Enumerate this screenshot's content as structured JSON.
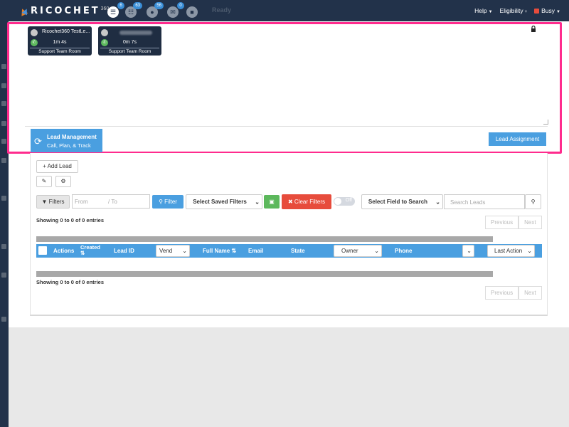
{
  "app": {
    "logo_text": "RICOCHET",
    "logo_number": "360",
    "status": "Ready"
  },
  "topbar": {
    "icons": [
      {
        "icon": "phone-book-icon",
        "badge": "6"
      },
      {
        "icon": "document-icon",
        "badge": "63"
      },
      {
        "icon": "chat-icon",
        "badge": "56"
      },
      {
        "icon": "mail-icon",
        "badge": "0"
      },
      {
        "icon": "inbox-icon",
        "badge": ""
      }
    ],
    "help_label": "Help",
    "eligibility_label": "Eligibility",
    "busy_label": "Busy",
    "busy_color": "#e74c3c"
  },
  "call_panel": {
    "cards": [
      {
        "name": "Ricochet360 TestLe...",
        "duration": "1m 4s",
        "room": "Support Team Room"
      },
      {
        "name": "",
        "duration": "0m 7s",
        "room": "Support Team Room"
      }
    ],
    "lead_management_title": "Lead Management",
    "lead_management_subtitle": "Call, Plan, & Track",
    "lead_assignment_label": "Lead Assignment"
  },
  "toolbar": {
    "add_lead_label": "Add Lead",
    "filters_label": "Filters",
    "from_placeholder": "From",
    "to_placeholder": "To",
    "filter_label": "Filter",
    "saved_filters_label": "Select Saved Filters",
    "clear_filters_label": "Clear Filters",
    "toggle_label": "Off",
    "search_field_label": "Select Field to Search",
    "search_placeholder": "Search Leads"
  },
  "table": {
    "info_top": "Showing 0 to 0 of 0 entries",
    "info_bottom": "Showing 0 to 0 of 0 entries",
    "previous_label": "Previous",
    "next_label": "Next",
    "columns": {
      "actions": "Actions",
      "created": "Created",
      "lead_id": "Lead ID",
      "vendor": "Vend",
      "full_name": "Full Name",
      "email": "Email",
      "state": "State",
      "owner": "Owner",
      "phone": "Phone",
      "last_action": "Last Action"
    }
  },
  "colors": {
    "accent": "#4a9fe0",
    "highlight": "#ff2b8d",
    "topbar": "#22324a",
    "danger": "#e74c3c",
    "success": "#5cb85c"
  }
}
